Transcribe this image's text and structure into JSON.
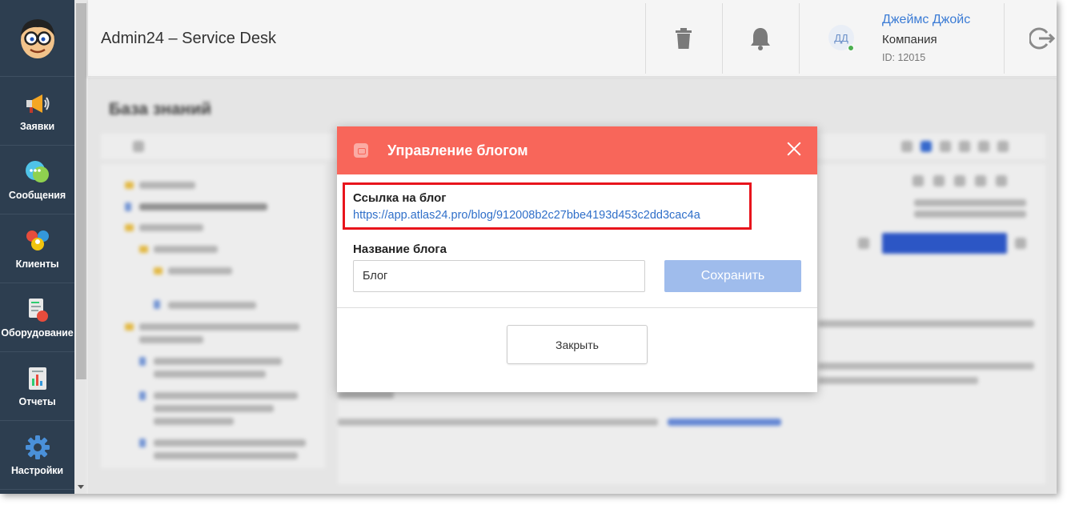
{
  "app": {
    "title": "Admin24 – Service Desk"
  },
  "sidebar": {
    "items": [
      {
        "label": "Заявки",
        "icon": "megaphone-icon"
      },
      {
        "label": "Сообщения",
        "icon": "chat-icon"
      },
      {
        "label": "Клиенты",
        "icon": "clients-icon"
      },
      {
        "label": "Оборудование",
        "icon": "equipment-icon"
      },
      {
        "label": "Отчеты",
        "icon": "reports-icon"
      },
      {
        "label": "Настройки",
        "icon": "gear-icon"
      }
    ]
  },
  "header": {
    "trash_icon": "trash-icon",
    "bell_icon": "bell-icon",
    "logout_icon": "logout-icon",
    "user": {
      "initials": "ДД",
      "name": "Джеймс Джойс",
      "company": "Компания",
      "id_text": "ID: 12015"
    }
  },
  "background": {
    "page_title": "База знаний"
  },
  "modal": {
    "title": "Управление блогом",
    "link_label": "Ссылка на блог",
    "link_url": "https://app.atlas24.pro/blog/912008b2c27bbe4193d453c2dd3cac4a",
    "name_label": "Название блога",
    "name_value": "Блог",
    "save_label": "Сохранить",
    "close_label": "Закрыть"
  },
  "colors": {
    "sidebar_bg": "#2d3e50",
    "modal_header": "#f8665a",
    "highlight_border": "#e8141c",
    "save_button": "#9fbcec",
    "link": "#2f6fc9"
  }
}
